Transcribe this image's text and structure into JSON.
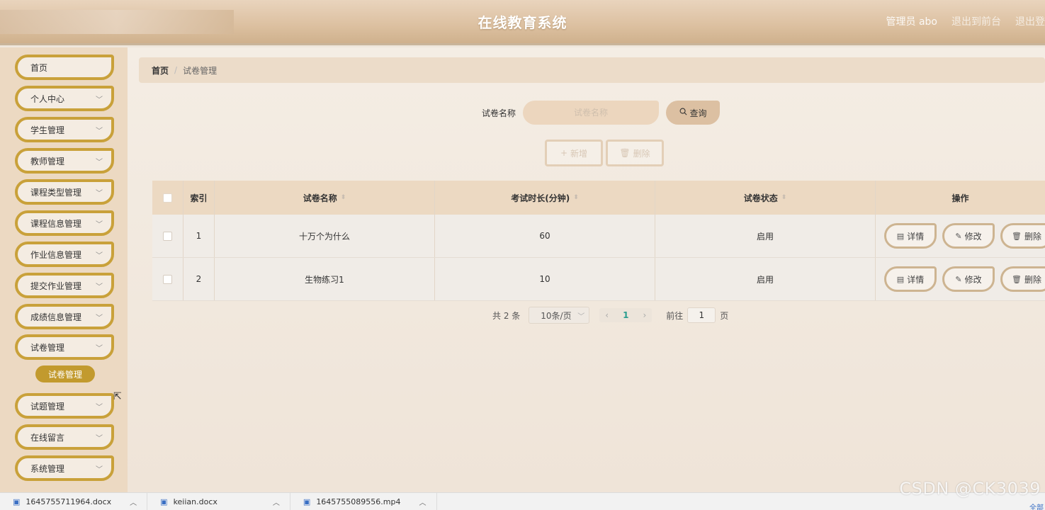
{
  "header": {
    "title": "在线教育系统",
    "user": "管理员 abo",
    "to_front": "退出到前台",
    "logout": "退出登"
  },
  "sidebar": {
    "items": [
      {
        "label": "首页",
        "has_chevron": false
      },
      {
        "label": "个人中心",
        "has_chevron": true
      },
      {
        "label": "学生管理",
        "has_chevron": true
      },
      {
        "label": "教师管理",
        "has_chevron": true
      },
      {
        "label": "课程类型管理",
        "has_chevron": true
      },
      {
        "label": "课程信息管理",
        "has_chevron": true
      },
      {
        "label": "作业信息管理",
        "has_chevron": true
      },
      {
        "label": "提交作业管理",
        "has_chevron": true
      },
      {
        "label": "成绩信息管理",
        "has_chevron": true
      },
      {
        "label": "试卷管理",
        "has_chevron": true
      },
      {
        "label": "试题管理",
        "has_chevron": true
      },
      {
        "label": "在线留言",
        "has_chevron": true
      },
      {
        "label": "系统管理",
        "has_chevron": true
      }
    ],
    "active_sub": "试卷管理"
  },
  "breadcrumb": {
    "home": "首页",
    "separator": "/",
    "current": "试卷管理"
  },
  "search": {
    "label": "试卷名称",
    "placeholder": "试卷名称",
    "query_label": "查询"
  },
  "actions": {
    "add_label": "新增",
    "delete_label": "删除"
  },
  "table": {
    "headers": {
      "index": "索引",
      "name": "试卷名称",
      "duration": "考试时长(分钟)",
      "status": "试卷状态",
      "ops": "操作"
    },
    "rows": [
      {
        "index": "1",
        "name": "十万个为什么",
        "duration": "60",
        "status": "启用"
      },
      {
        "index": "2",
        "name": "生物练习1",
        "duration": "10",
        "status": "启用"
      }
    ],
    "op_labels": {
      "detail": "详情",
      "edit": "修改",
      "delete": "删除"
    }
  },
  "pagination": {
    "total": "共 2 条",
    "page_size": "10条/页",
    "current_page": "1",
    "goto_label": "前往",
    "goto_value": "1",
    "page_suffix": "页"
  },
  "taskbar": {
    "downloads": [
      {
        "name": "1645755711964.docx"
      },
      {
        "name": "keiian.docx"
      },
      {
        "name": "1645755089556.mp4"
      }
    ],
    "show_all": "全部"
  },
  "watermark": "CSDN @CK3039",
  "colors": {
    "accent": "#c9a13a",
    "active_sub_bg": "#c29a2e",
    "pager_current": "#2a9d8f"
  }
}
